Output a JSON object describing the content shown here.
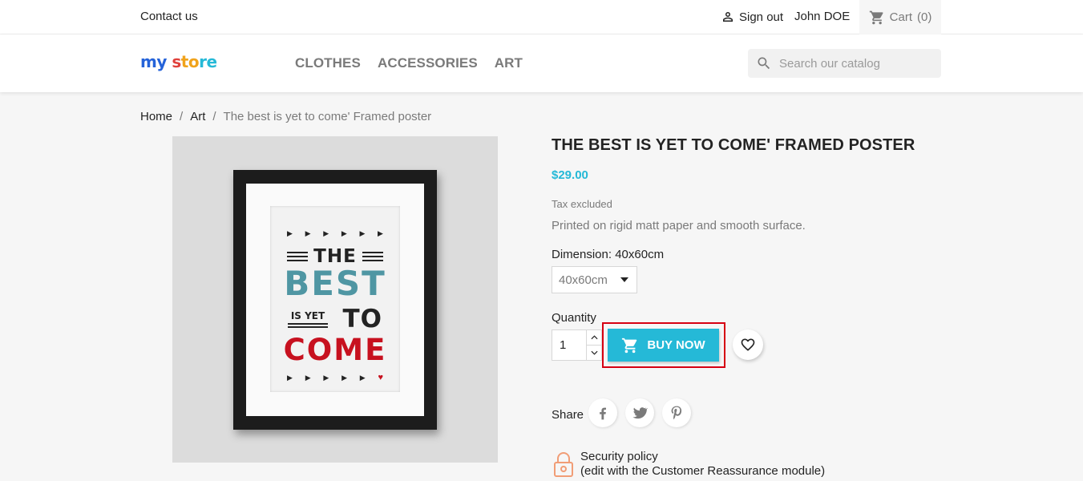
{
  "topbar": {
    "contact_label": "Contact us",
    "signout_label": "Sign out",
    "user_name": "John DOE",
    "cart_label": "Cart",
    "cart_count": "(0)"
  },
  "header": {
    "logo": {
      "part1": "my",
      "part2": "s",
      "part3": "to",
      "part4": "re"
    },
    "nav": [
      {
        "label": "CLOTHES"
      },
      {
        "label": "ACCESSORIES"
      },
      {
        "label": "ART"
      }
    ],
    "search_placeholder": "Search our catalog"
  },
  "breadcrumb": {
    "items": [
      "Home",
      "Art",
      "The best is yet to come' Framed poster"
    ],
    "separator": "/"
  },
  "poster": {
    "line1": "THE",
    "line2": "BEST",
    "line3": "IS YET",
    "line4": "TO",
    "line5": "COME"
  },
  "product": {
    "title": "THE BEST IS YET TO COME' FRAMED POSTER",
    "price": "$29.00",
    "tax_label": "Tax excluded",
    "description": "Printed on rigid matt paper and smooth surface.",
    "dimension_label": "Dimension: 40x60cm",
    "dimension_value": "40x60cm",
    "quantity_label": "Quantity",
    "quantity_value": "1",
    "buy_label": "BUY NOW",
    "share_label": "Share",
    "reassurance_line1": "Security policy",
    "reassurance_line2": "(edit with the Customer Reassurance module)"
  },
  "colors": {
    "accent": "#25b9d7",
    "highlight": "#d60012",
    "text": "#232323",
    "muted": "#7a7a7a"
  },
  "icons": {
    "user": "user-icon",
    "cart": "cart-icon",
    "search": "search-icon",
    "dropdown": "caret-down-icon",
    "wishlist": "heart-icon",
    "facebook": "facebook-icon",
    "twitter": "twitter-icon",
    "pinterest": "pinterest-icon",
    "security": "lock-icon"
  }
}
